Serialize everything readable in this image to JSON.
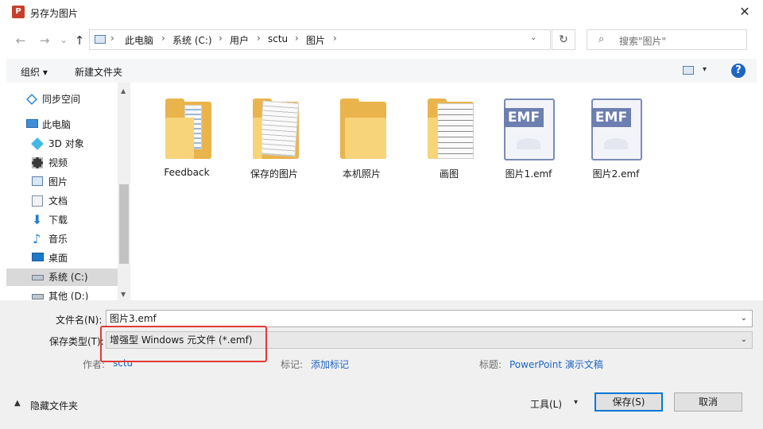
{
  "window": {
    "app_icon": "powerpoint-icon",
    "title": "另存为图片",
    "close": "✕"
  },
  "nav": {
    "back": "←",
    "forward": "→",
    "recent": "⌄",
    "up": "↑",
    "breadcrumbs": [
      "此电脑",
      "系统 (C:)",
      "用户",
      "sctu",
      "图片"
    ],
    "separator": "›",
    "refresh": "↻",
    "search_placeholder": "搜索\"图片\""
  },
  "toolbar": {
    "organize": "组织 ▾",
    "new_folder": "新建文件夹",
    "help": "?"
  },
  "sidebar": {
    "items": [
      {
        "label": "同步空间",
        "icon": "sync-space-icon"
      },
      {
        "label": "此电脑",
        "icon": "computer-icon"
      },
      {
        "label": "3D 对象",
        "icon": "3d-objects-icon"
      },
      {
        "label": "视频",
        "icon": "video-icon"
      },
      {
        "label": "图片",
        "icon": "pictures-icon"
      },
      {
        "label": "文档",
        "icon": "documents-icon"
      },
      {
        "label": "下载",
        "icon": "download-icon"
      },
      {
        "label": "音乐",
        "icon": "music-icon"
      },
      {
        "label": "桌面",
        "icon": "desktop-icon"
      },
      {
        "label": "系统 (C:)",
        "icon": "drive-icon"
      },
      {
        "label": "其他 (D:)",
        "icon": "drive-icon"
      }
    ]
  },
  "files": [
    {
      "name": "Feedback",
      "type": "folder"
    },
    {
      "name": "保存的图片",
      "type": "folder"
    },
    {
      "name": "本机照片",
      "type": "folder"
    },
    {
      "name": "画图",
      "type": "folder"
    },
    {
      "name": "图片1.emf",
      "type": "emf",
      "badge": "EMF"
    },
    {
      "name": "图片2.emf",
      "type": "emf",
      "badge": "EMF"
    }
  ],
  "form": {
    "filename_label": "文件名(N):",
    "filename_value": "图片3.emf",
    "filetype_label": "保存类型(T):",
    "filetype_value": "增强型 Windows 元文件 (*.emf)",
    "author_label": "作者:",
    "author_value": "sctu",
    "tags_label": "标记:",
    "tags_value": "添加标记",
    "title_label": "标题:",
    "title_value": "PowerPoint 演示文稿"
  },
  "footer": {
    "hide_folders": "隐藏文件夹",
    "tools": "工具(L)",
    "tools_arrow": "▾",
    "save": "保存(S)",
    "cancel": "取消"
  },
  "colors": {
    "highlight": "#e23a34",
    "accent": "#0078d7",
    "link": "#1d66c2"
  }
}
